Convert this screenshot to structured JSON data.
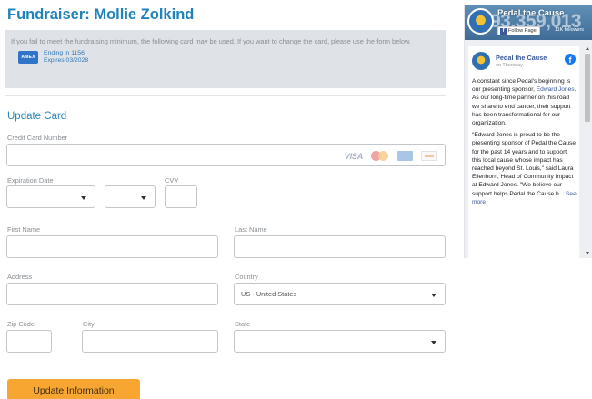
{
  "page": {
    "title": "Fundraiser: Mollie Zolkind"
  },
  "notice": {
    "text": "If you fail to meet the fundraising minimum, the following card may be used. If you want to change the card, please use the form below.",
    "card_ending": "Ending in 1156",
    "card_expires": "Expires 03/2028",
    "card_icon": "amex-card-icon"
  },
  "form": {
    "section_title": "Update Card",
    "credit_card_label": "Credit Card Number",
    "credit_card_value": "",
    "card_brand_icons": [
      "visa-icon",
      "mastercard-icon",
      "amex-icon",
      "discover-icon"
    ],
    "visa_text": "VISA",
    "expiration_label": "Expiration Date",
    "exp_month_value": "",
    "exp_year_value": "",
    "cvv_label": "CVV",
    "cvv_value": "",
    "first_name_label": "First Name",
    "first_name_value": "",
    "last_name_label": "Last Name",
    "last_name_value": "",
    "address_label": "Address",
    "address_value": "",
    "country_label": "Country",
    "country_value": "US - United States",
    "zip_label": "Zip Code",
    "zip_value": "",
    "city_label": "City",
    "city_value": "",
    "state_label": "State",
    "state_value": "",
    "submit_label": "Update Information"
  },
  "colors": {
    "title": "#1e83b8",
    "notice_bg": "#dfe3e7",
    "button": "#f7a632",
    "facebook": "#1877f2"
  },
  "facebook_widget": {
    "cover_title": "Pedal the Cause",
    "cover_number": "93,359,013",
    "follow_label": "Follow Page",
    "followers": "11K followers",
    "post_page_name": "Pedal the Cause",
    "post_date": "on Thursday",
    "post_p1_a": "A constant since Pedal's beginning is our presenting sponsor,",
    "post_p1_link": "Edward Jones",
    "post_p1_b": ". As our long-time partner on this road we share to end cancer, their support has been transformational for our organization.",
    "post_p2": "\"Edward Jones is proud to be the presenting sponsor of Pedal the Cause for the past 14 years and to support this local cause whose impact has reached beyond St. Louis,\" said Laura Ellenhorn, Head of Community Impact at Edward Jones. \"We believe our support helps Pedal the Cause b...",
    "see_more": "See more"
  }
}
